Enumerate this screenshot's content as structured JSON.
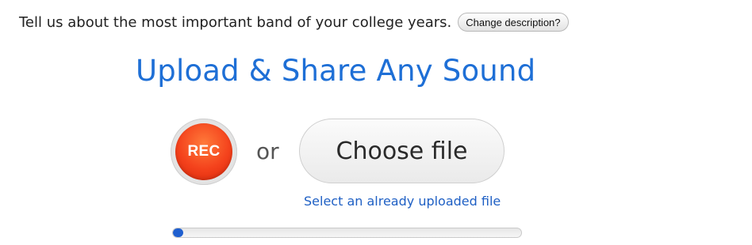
{
  "description": {
    "text": "Tell us about the most important band of your college years.",
    "change_button_label": "Change description?"
  },
  "upload": {
    "title": "Upload & Share Any Sound",
    "rec_label": "REC",
    "or_label": "or",
    "choose_file_label": "Choose file",
    "select_uploaded_link": "Select an already uploaded file"
  },
  "progress": {
    "fraction": 0.03
  },
  "colors": {
    "title_blue": "#1e6fd6",
    "link_blue": "#1e5fc4",
    "rec_red": "#f4421c",
    "progress_blue": "#1f5fcf"
  }
}
